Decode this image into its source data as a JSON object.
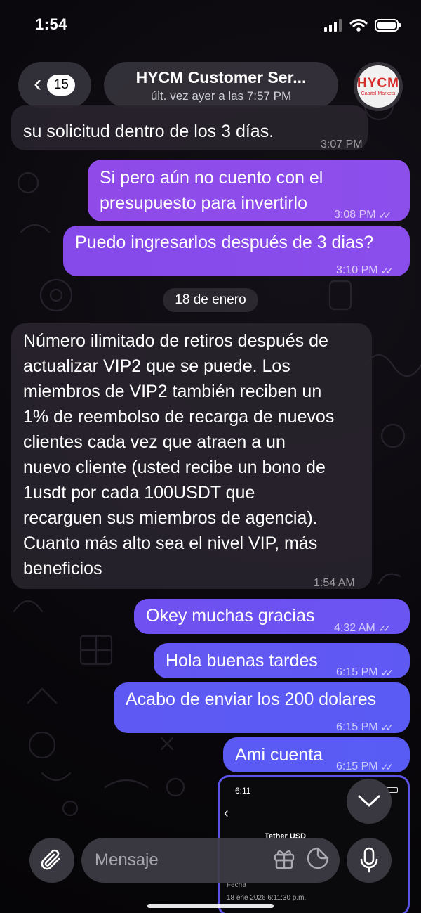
{
  "status_bar": {
    "time": "1:54"
  },
  "header": {
    "back_count": "15",
    "title": "HYCM Customer Ser...",
    "subtitle": "últ. vez ayer a las 7:57 PM",
    "avatar_logo": "HYCM",
    "avatar_sub": "Capital Markets"
  },
  "messages": [
    {
      "direction": "in",
      "text": "su solicitud dentro de los 3 días.",
      "time": "3:07 PM"
    },
    {
      "direction": "out",
      "text_lines": [
        "Si pero aún no cuento con el",
        "presupuesto para invertirlo"
      ],
      "time": "3:08 PM"
    },
    {
      "direction": "out",
      "text": "Puedo ingresarlos después de 3 dias?",
      "time": "3:10 PM"
    },
    {
      "direction": "in",
      "text_lines": [
        "Número ilimitado de retiros después de",
        "actualizar VIP2 que se puede. Los",
        "miembros de VIP2 también reciben un",
        "1% de reembolso de recarga de nuevos",
        "clientes cada vez que atraen a un",
        "nuevo cliente (usted recibe un bono de",
        "1usdt por cada 100USDT que",
        "recarguen sus miembros de agencia).",
        "Cuanto más alto sea el nivel VIP, más",
        "beneficios"
      ],
      "time": "1:54 AM"
    },
    {
      "direction": "out",
      "text": "Okey muchas gracias",
      "time": "4:32 AM"
    },
    {
      "direction": "out",
      "text": "Hola buenas tardes",
      "time": "6:15 PM"
    },
    {
      "direction": "out",
      "text": "Acabo de enviar los 200 dolares",
      "time": "6:15 PM"
    },
    {
      "direction": "out",
      "text": "Ami cuenta",
      "time": "6:15 PM"
    }
  ],
  "date_separator": "18 de enero",
  "attachment_preview": {
    "time": "6:11",
    "title": "Tether USD",
    "label": "Fecha",
    "date": "18 ene 2026 6:11:30 p.m."
  },
  "input": {
    "placeholder": "Mensaje"
  },
  "colors": {
    "outgoing_top": "#8d4bea",
    "outgoing_bottom": "#5a57f4",
    "incoming": "#28242c",
    "accent_red": "#d62b2b"
  },
  "icons": {
    "back": "chevron-left-icon",
    "attach": "paperclip-icon",
    "gift": "gift-icon",
    "sticker": "sticker-icon",
    "mic": "microphone-icon",
    "scroll": "chevron-down-icon"
  }
}
